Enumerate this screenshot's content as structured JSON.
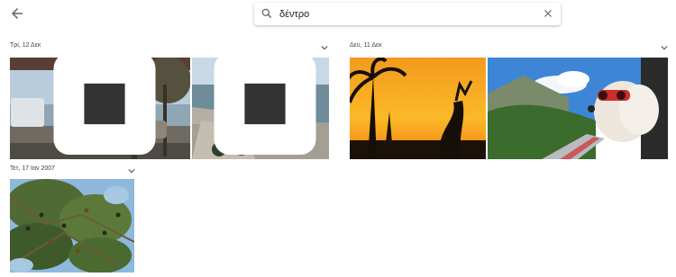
{
  "header": {
    "back_icon": "arrow-left-icon",
    "search": {
      "value": "δέντρο",
      "icon": "search-icon",
      "clear_icon": "close-icon"
    }
  },
  "groups": [
    {
      "date": "Τρί, 12 Δεκ",
      "photos": [
        "photo-street-promenade",
        "photo-waterfront-ship"
      ]
    },
    {
      "date": "Δευ, 11 Δεκ",
      "photos": [
        "photo-palm-sunset",
        "photo-dog-car-window"
      ]
    },
    {
      "date": "Τετ, 17 Ιαν 2007",
      "photos": [
        "photo-olive-tree"
      ]
    }
  ]
}
